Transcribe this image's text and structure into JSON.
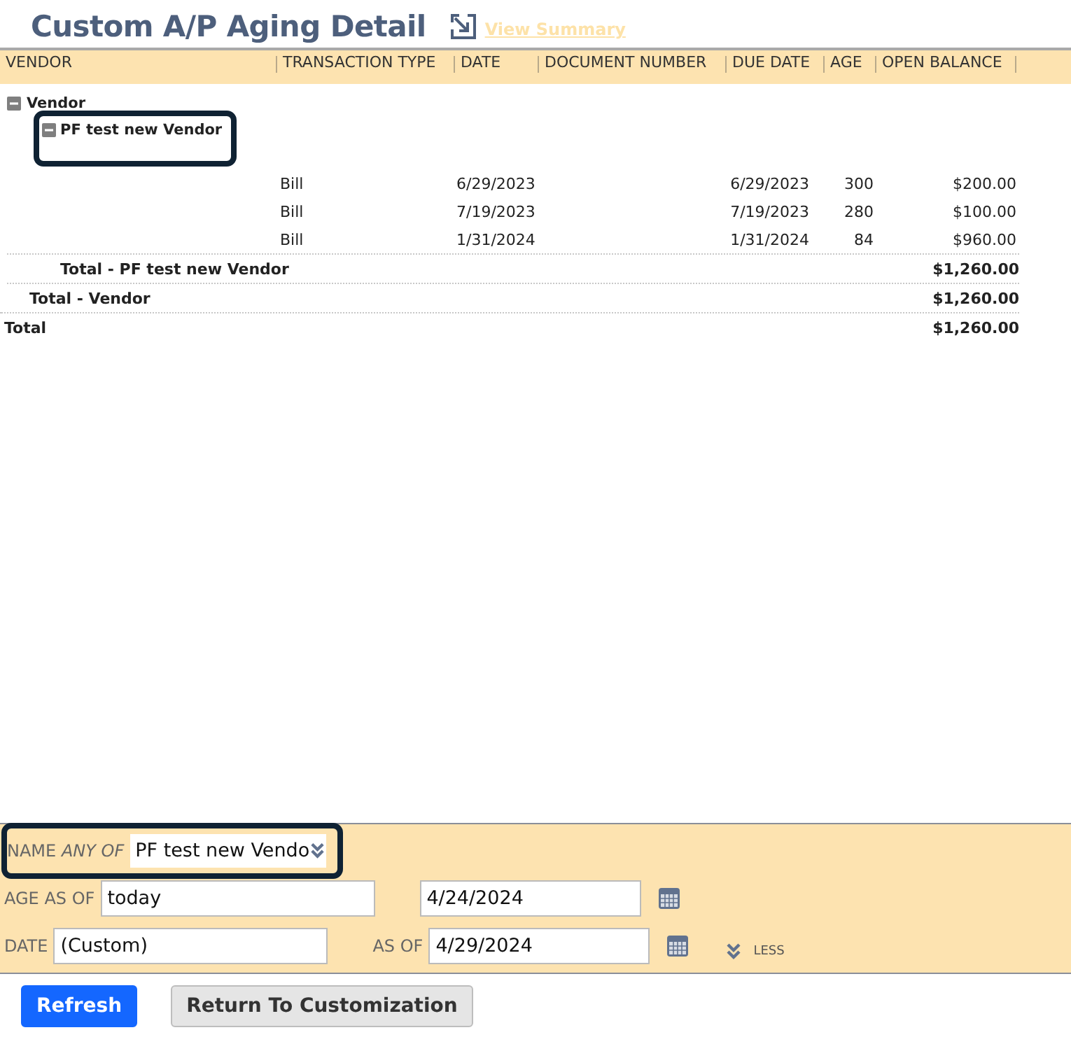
{
  "title": "Custom A/P Aging Detail",
  "view_link": "View Summary",
  "columns": [
    "VENDOR",
    "TRANSACTION TYPE",
    "DATE",
    "DOCUMENT NUMBER",
    "DUE DATE",
    "AGE",
    "OPEN BALANCE"
  ],
  "groups": [
    {
      "label": "Vendor",
      "expanded": true,
      "total_label": "Total - Vendor",
      "total": "$1,260.00",
      "children": [
        {
          "label": "PF test new Vendor",
          "expanded": true,
          "highlighted": true,
          "total_label": "Total - PF test new Vendor",
          "total": "$1,260.00",
          "rows": [
            {
              "type": "Bill",
              "date": "6/29/2023",
              "due_date": "6/29/2023",
              "age": "300",
              "open_balance": "$200.00"
            },
            {
              "type": "Bill",
              "date": "7/19/2023",
              "due_date": "7/19/2023",
              "age": "280",
              "open_balance": "$100.00"
            },
            {
              "type": "Bill",
              "date": "1/31/2024",
              "due_date": "1/31/2024",
              "age": "84",
              "open_balance": "$960.00"
            }
          ]
        }
      ]
    }
  ],
  "grand_total": {
    "label": "Total",
    "value": "$1,260.00"
  },
  "filters": {
    "name": {
      "label": "NAME",
      "qualifier": "ANY OF",
      "value": "PF test new Vendo",
      "highlighted": true
    },
    "age_as_of": {
      "label": "AGE AS OF",
      "value": "today",
      "date": "4/24/2024"
    },
    "date": {
      "label": "DATE",
      "value": "(Custom)",
      "as_of_label": "AS OF",
      "as_of": "4/29/2024"
    },
    "toggle": "LESS"
  },
  "buttons": [
    {
      "label": "Refresh",
      "kind": "primary"
    },
    {
      "label": "Return To Customization",
      "kind": "secondary"
    }
  ]
}
